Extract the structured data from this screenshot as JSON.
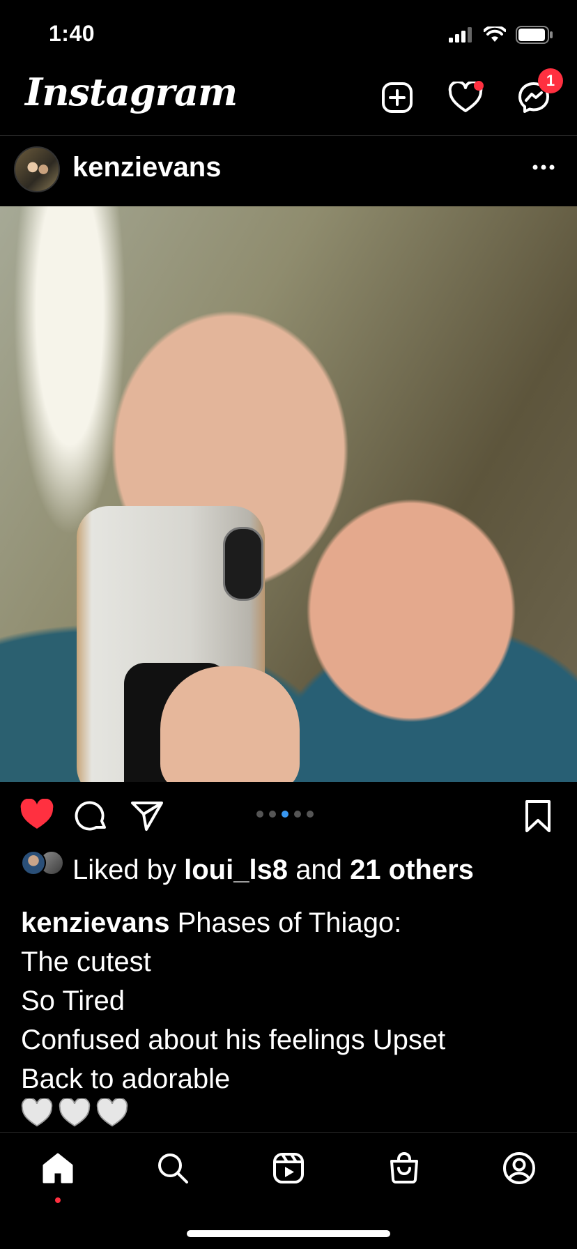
{
  "status_bar": {
    "time": "1:40"
  },
  "header": {
    "logo": "Instagram",
    "messages_badge": "1"
  },
  "post": {
    "username": "kenzievans",
    "carousel": {
      "count": 5,
      "active_index": 2
    },
    "liked": true,
    "likes": {
      "prefix": "Liked by",
      "user": "loui_ls8",
      "connector": "and",
      "others": "21 others"
    },
    "caption": {
      "username": "kenzievans",
      "first_line": "Phases of Thiago:",
      "lines": [
        "The cutest",
        "So Tired",
        "Confused about his feelings Upset",
        "Back to adorable"
      ],
      "emoji": "🤍🤍🤍"
    }
  },
  "colors": {
    "accent_red": "#ff3040",
    "carousel_active": "#3897f0",
    "background": "#000000"
  },
  "icons": {
    "header": [
      "plus-square-icon",
      "heart-icon",
      "messenger-icon"
    ],
    "actions": [
      "heart-filled-icon",
      "comment-icon",
      "share-icon",
      "bookmark-icon"
    ],
    "nav": [
      "home-icon",
      "search-icon",
      "reels-icon",
      "shop-icon",
      "profile-icon"
    ]
  }
}
